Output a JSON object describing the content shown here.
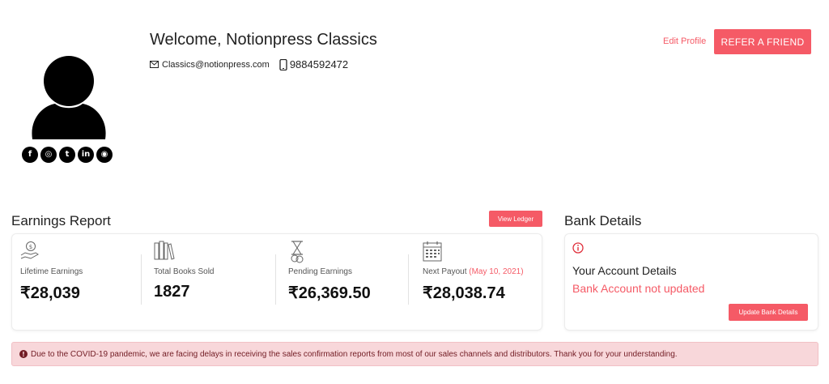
{
  "profile": {
    "welcome": "Welcome, Notionpress Classics",
    "email": "Classics@notionpress.com",
    "phone": "9884592472",
    "edit_profile": "Edit Profile",
    "refer_button": "REFER A FRIEND",
    "socials": [
      {
        "icon": "facebook-icon",
        "glyph": "f"
      },
      {
        "icon": "globe-icon",
        "glyph": "◎"
      },
      {
        "icon": "twitter-icon",
        "glyph": "t"
      },
      {
        "icon": "linkedin-icon",
        "glyph": "in"
      },
      {
        "icon": "instagram-icon",
        "glyph": "◉"
      }
    ]
  },
  "earnings": {
    "title": "Earnings Report",
    "view_ledger": "View Ledger",
    "stats": [
      {
        "icon": "money-hand-icon",
        "label": "Lifetime Earnings",
        "value": "₹28,039"
      },
      {
        "icon": "books-icon",
        "label": "Total Books Sold",
        "value": "1827"
      },
      {
        "icon": "hourglass-money-icon",
        "label": "Pending Earnings",
        "value": "₹26,369.50"
      },
      {
        "icon": "calendar-icon",
        "label": "Next Payout",
        "date": "(May 10, 2021)",
        "value": "₹28,038.74"
      }
    ]
  },
  "bank": {
    "title": "Bank Details",
    "account_title": "Your Account Details",
    "status": "Bank Account not updated",
    "update_button": "Update Bank Details"
  },
  "notice": {
    "text": "Due to the COVID-19 pandemic, we are facing delays in receiving the sales confirmation reports from most of our sales channels and distributors. Thank you for your understanding."
  },
  "colors": {
    "accent": "#f55a66",
    "notice_bg": "#f8d7da",
    "notice_text": "#721c24"
  }
}
